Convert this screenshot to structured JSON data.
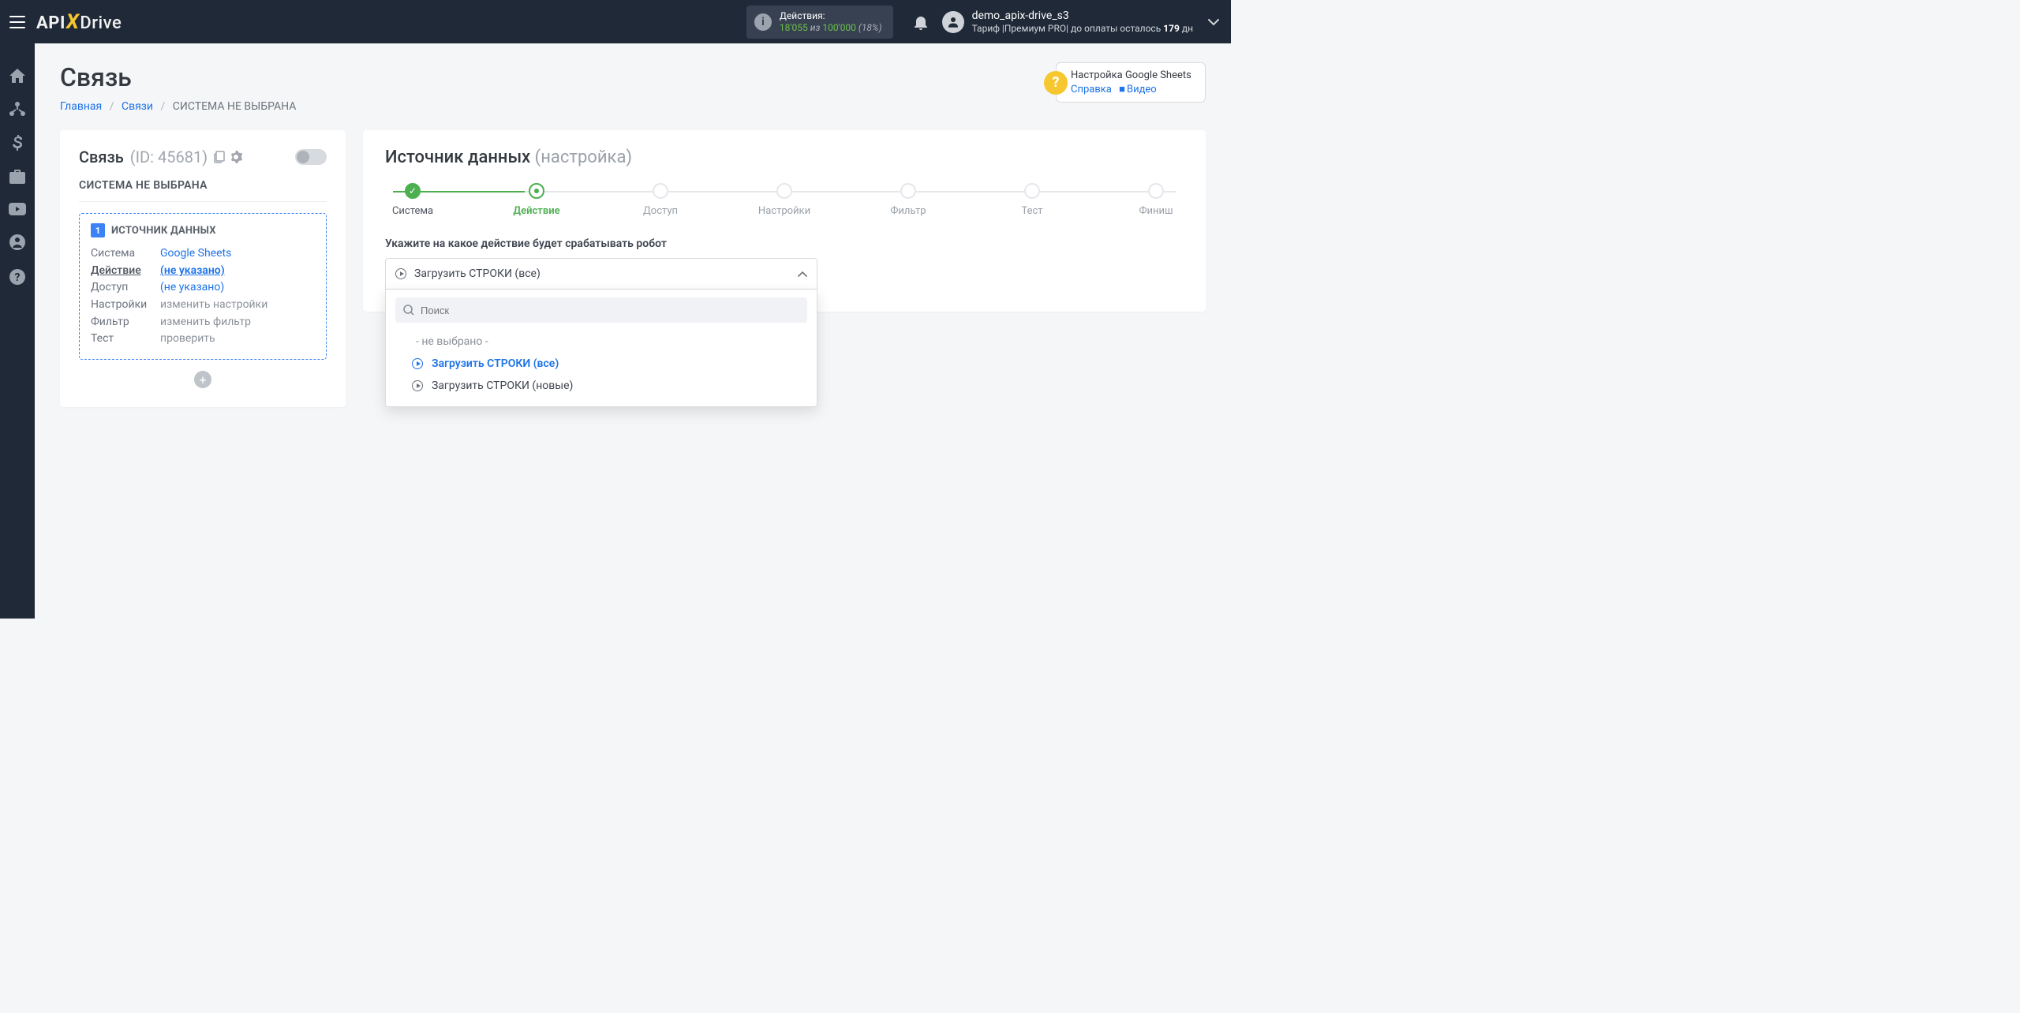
{
  "header": {
    "logo": {
      "p1": "API",
      "p2": "X",
      "p3": "Drive"
    },
    "actions": {
      "label": "Действия:",
      "used": "18'055",
      "sep": "из",
      "total": "100'000",
      "pct": "(18%)"
    },
    "user": {
      "name": "demo_apix-drive_s3",
      "tariff_prefix": "Тариф |",
      "tariff_name": "Премиум PRO",
      "tariff_suffix": "| до оплаты осталось ",
      "days": "179",
      "days_unit": " дн"
    }
  },
  "page": {
    "title": "Связь",
    "breadcrumb": {
      "home": "Главная",
      "links": "Связи",
      "current": "СИСТЕМА НЕ ВЫБРАНА"
    }
  },
  "help": {
    "title": "Настройка Google Sheets",
    "ref": "Справка",
    "video": "Видео"
  },
  "left_card": {
    "title": "Связь",
    "id_label": "(ID: 45681)",
    "subtitle": "СИСТЕМА НЕ ВЫБРАНА",
    "source_header": "ИСТОЧНИК ДАННЫХ",
    "rows": {
      "system": {
        "k": "Система",
        "v": "Google Sheets"
      },
      "action": {
        "k": "Действие",
        "v": "(не указано)"
      },
      "access": {
        "k": "Доступ",
        "v": "(не указано)"
      },
      "settings": {
        "k": "Настройки",
        "v": "изменить настройки"
      },
      "filter": {
        "k": "Фильтр",
        "v": "изменить фильтр"
      },
      "test": {
        "k": "Тест",
        "v": "проверить"
      }
    }
  },
  "right_card": {
    "title_main": "Источник данных",
    "title_sub": "(настройка)",
    "steps": [
      "Система",
      "Действие",
      "Доступ",
      "Настройки",
      "Фильтр",
      "Тест",
      "Финиш"
    ],
    "field_label": "Укажите на какое действие будет срабатывать робот",
    "selected": "Загрузить СТРОКИ (все)",
    "search_placeholder": "Поиск",
    "options": {
      "none": "- не выбрано -",
      "all": "Загрузить СТРОКИ (все)",
      "new": "Загрузить СТРОКИ (новые)"
    }
  }
}
